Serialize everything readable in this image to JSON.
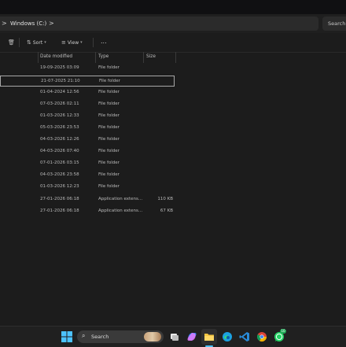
{
  "address": {
    "path": [
      "Windows (C:)"
    ],
    "separator": ">",
    "search_placeholder": "Search"
  },
  "toolbar": {
    "sort_label": "Sort",
    "view_label": "View",
    "more_label": "..."
  },
  "columns": {
    "date_modified": "Date modified",
    "type": "Type",
    "size": "Size"
  },
  "rows": [
    {
      "date": "19-09-2025 03:09",
      "type": "File folder",
      "size": ""
    },
    {
      "date": "21-07-2025 21:10",
      "type": "File folder",
      "size": ""
    },
    {
      "date": "01-04-2024 12:56",
      "type": "File folder",
      "size": ""
    },
    {
      "date": "07-03-2026 02:11",
      "type": "File folder",
      "size": ""
    },
    {
      "date": "01-03-2026 12:33",
      "type": "File folder",
      "size": ""
    },
    {
      "date": "05-03-2026 23:53",
      "type": "File folder",
      "size": ""
    },
    {
      "date": "04-03-2026 12:26",
      "type": "File folder",
      "size": ""
    },
    {
      "date": "04-03-2026 07:40",
      "type": "File folder",
      "size": ""
    },
    {
      "date": "07-01-2026 03:15",
      "type": "File folder",
      "size": ""
    },
    {
      "date": "04-03-2026 23:58",
      "type": "File folder",
      "size": ""
    },
    {
      "date": "01-03-2026 12:23",
      "type": "File folder",
      "size": ""
    },
    {
      "date": "27-01-2026 06:18",
      "type": "Application extens...",
      "size": "110 KB"
    },
    {
      "date": "27-01-2026 06:18",
      "type": "Application extens...",
      "size": "67 KB"
    }
  ],
  "selected_row_index": 1,
  "taskbar": {
    "search_label": "Search",
    "whatsapp_badge": "10",
    "icons": [
      "windows-start",
      "search",
      "task-view",
      "copilot",
      "file-explorer",
      "edge",
      "vscode",
      "chrome",
      "whatsapp"
    ]
  },
  "colors": {
    "background": "#1c1c1c",
    "accent": "#4cc2ff",
    "selection_border": "#a8a8a8"
  }
}
